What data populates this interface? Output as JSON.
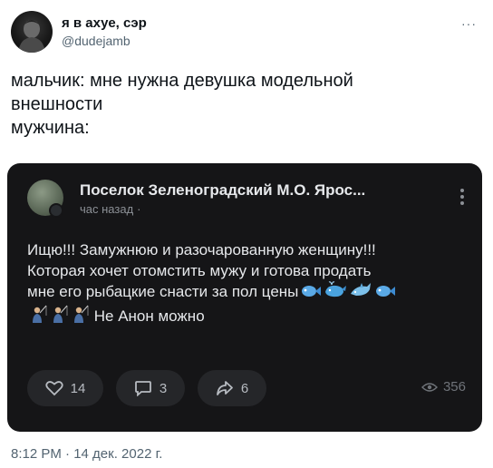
{
  "author": {
    "display_name": "я в ахуе, сэр",
    "handle": "@dudejamb",
    "avatar_icon": "avatar-icon",
    "more_label": "···"
  },
  "tweet": {
    "text": "мальчик: мне нужна девушка модельной\nвнешности\nмужчина:",
    "timestamp": "8:12 PM · 14 дек. 2022 г."
  },
  "screenshot_card": {
    "group_name": "Поселок Зеленоградский М.О. Ярос...",
    "post_time": "час назад",
    "post_time_suffix": "·",
    "lines": [
      "Ищю!!! Замужнюю и разочарованную женщину!!!",
      "Которая хочет отомстить мужу и готова продать",
      "мне его рыбацкие снасти за пол цены",
      "Не Анон можно"
    ],
    "emojis": [
      "fish-icon",
      "whale-icon",
      "dolphin-icon",
      "fish-icon"
    ],
    "fisher_icons": [
      "fisherman-icon",
      "fisherman-icon",
      "fisherman-icon"
    ],
    "likes": "14",
    "comments": "3",
    "shares": "6",
    "views": "356",
    "colors": {
      "card_bg": "#151517",
      "pill_bg": "#252629",
      "text": "#e6e8eb",
      "muted": "#8c9096"
    }
  }
}
